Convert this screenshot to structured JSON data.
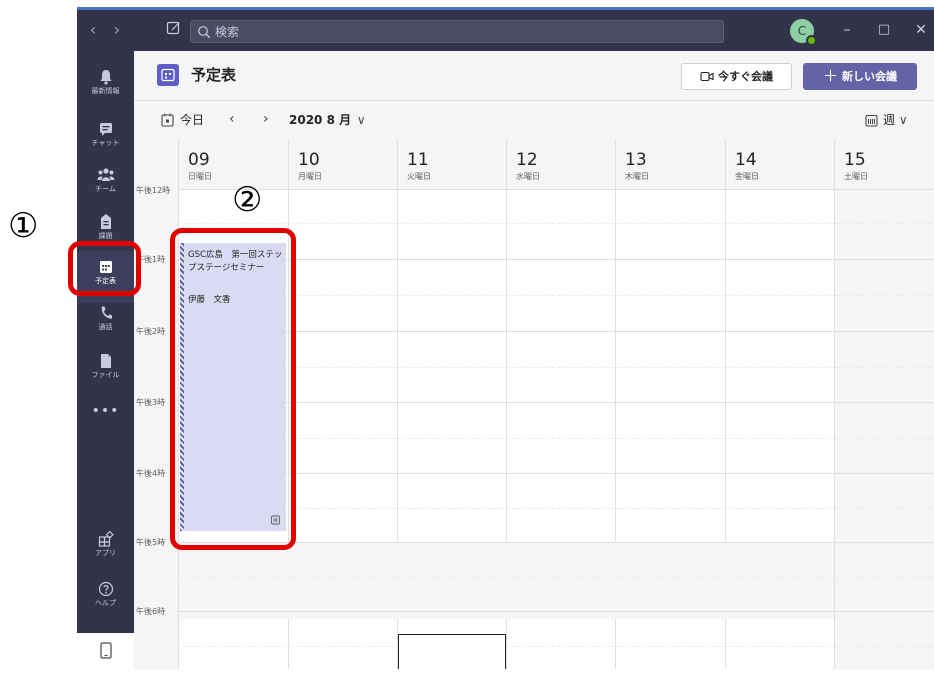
{
  "titlebar": {
    "search_placeholder": "検索",
    "avatar_initial": "C",
    "window_controls": [
      "–",
      "□",
      "✕"
    ]
  },
  "rail": {
    "items": [
      {
        "label": "最新情報",
        "icon": "bell-icon"
      },
      {
        "label": "チャット",
        "icon": "chat-icon"
      },
      {
        "label": "チーム",
        "icon": "teams-icon"
      },
      {
        "label": "課題",
        "icon": "assignments-icon"
      },
      {
        "label": "予定表",
        "icon": "calendar-icon",
        "active": true
      },
      {
        "label": "通話",
        "icon": "phone-icon"
      },
      {
        "label": "ファイル",
        "icon": "file-icon"
      },
      {
        "label": "アプリ",
        "icon": "apps-icon"
      },
      {
        "label": "ヘルプ",
        "icon": "help-icon"
      }
    ],
    "more": "•••"
  },
  "header": {
    "title": "予定表",
    "meet_now": "今すぐ会議",
    "new_meeting": "新しい会議"
  },
  "toolbar": {
    "today": "今日",
    "month": "2020 8 月",
    "view": "週"
  },
  "calendar": {
    "days": [
      {
        "num": "09",
        "name": "日曜日"
      },
      {
        "num": "10",
        "name": "月曜日"
      },
      {
        "num": "11",
        "name": "火曜日"
      },
      {
        "num": "12",
        "name": "水曜日"
      },
      {
        "num": "13",
        "name": "木曜日"
      },
      {
        "num": "14",
        "name": "金曜日"
      },
      {
        "num": "15",
        "name": "土曜日"
      }
    ],
    "times": [
      "午後12時",
      "午後1時",
      "午後2時",
      "午後3時",
      "午後4時",
      "午後5時",
      "午後6時"
    ],
    "event": {
      "title": "GSC広島　第一回ステップステージセミナー",
      "organizer": "伊藤　文香"
    }
  },
  "annotations": {
    "marker_1": "①",
    "marker_2": "②",
    "highlight_color": "#e00000"
  },
  "colors": {
    "accent": "#6264a7",
    "rail_bg": "#33344a",
    "top_accent": "#4b73c9"
  }
}
